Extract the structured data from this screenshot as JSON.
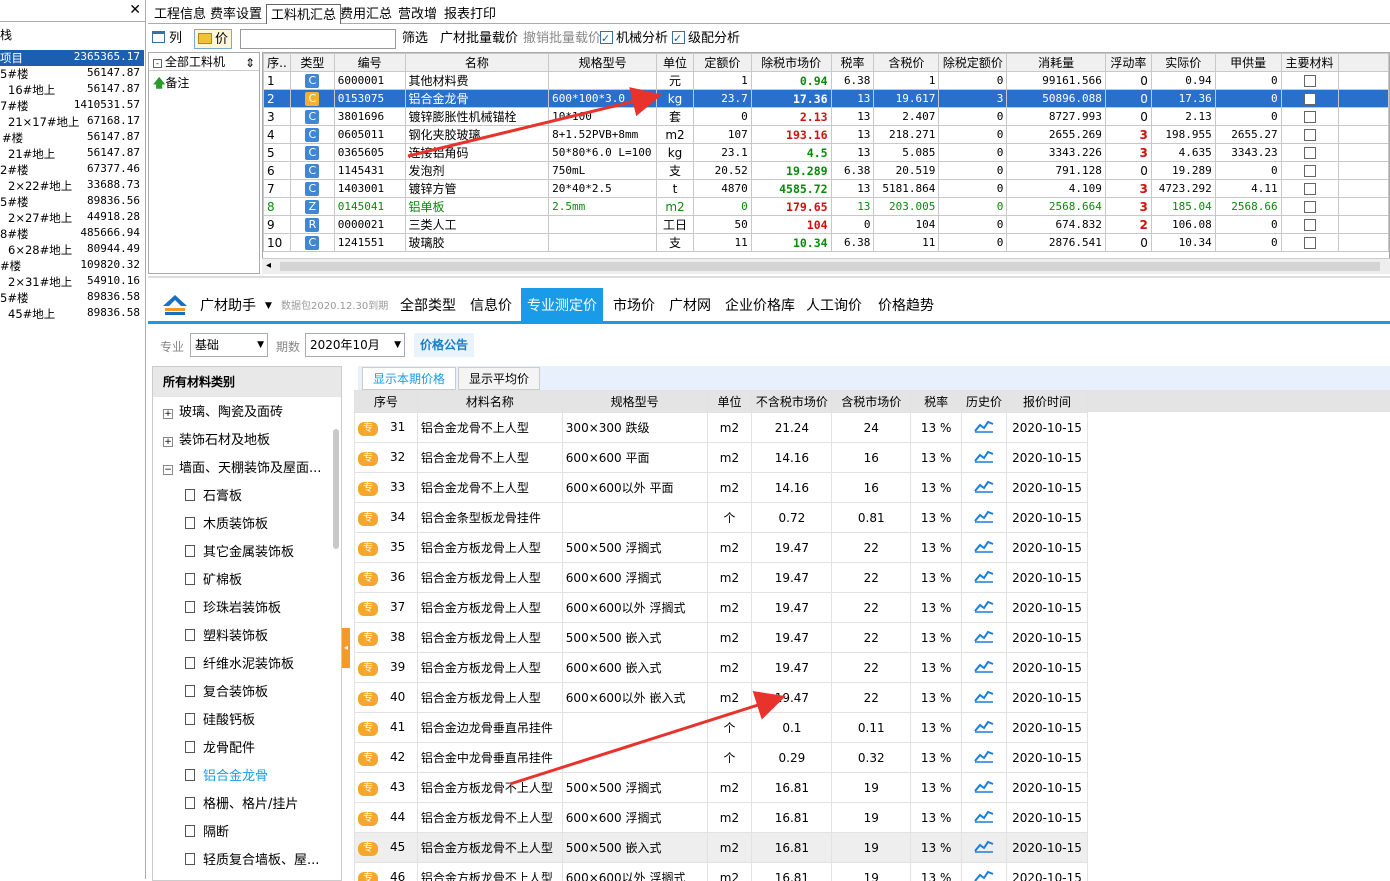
{
  "left_panel": {
    "caption": "栈",
    "rows": [
      {
        "name": "项目",
        "value": "2365365.17",
        "selected": true
      },
      {
        "name": "5#楼",
        "value": "56147.87"
      },
      {
        "name": "16#地上",
        "value": "56147.87"
      },
      {
        "name": "7#楼",
        "value": "1410531.57"
      },
      {
        "name": "21×17#地上",
        "value": "67168.17"
      },
      {
        "name": "#楼",
        "value": "56147.87"
      },
      {
        "name": "21#地上",
        "value": "56147.87"
      },
      {
        "name": "2#楼",
        "value": "67377.46"
      },
      {
        "name": "2×22#地上",
        "value": "33688.73"
      },
      {
        "name": "5#楼",
        "value": "89836.56"
      },
      {
        "name": "2×27#地上",
        "value": "44918.28"
      },
      {
        "name": "8#楼",
        "value": "485666.94"
      },
      {
        "name": "6×28#地上",
        "value": "80944.49"
      },
      {
        "name": "#楼",
        "value": "109820.32"
      },
      {
        "name": "2×31#地上",
        "value": "54910.16"
      },
      {
        "name": "5#楼",
        "value": "89836.58"
      },
      {
        "name": "45#地上",
        "value": "89836.58"
      }
    ]
  },
  "menu": [
    "工程信息",
    "费率设置",
    "工料机汇总",
    "费用汇总",
    "营改增",
    "报表打印"
  ],
  "toolbar": {
    "col_label": "列",
    "price_label": "价",
    "filter_label": "筛选",
    "batch_load": "广材批量载价",
    "undo_batch": "撤销批量载价",
    "machine_analysis": "机械分析",
    "grade_analysis": "级配分析"
  },
  "tree": {
    "header": "全部工料机",
    "note": "备注"
  },
  "grid1": {
    "columns": [
      "序..",
      "类型",
      "编号",
      "名称",
      "规格型号",
      "单位",
      "定额价",
      "除税市场价",
      "税率",
      "含税价",
      "除税定额价",
      "消耗量",
      "浮动率",
      "实际价",
      "甲供量",
      "主要材料"
    ],
    "rows": [
      {
        "no": "1",
        "type": "C",
        "code": "6000001",
        "name": "其他材料费",
        "spec": "",
        "unit": "元",
        "quota": "1",
        "market": "0.94",
        "tax": "6.38",
        "taxp": "1",
        "notax_q": "0",
        "qty": "99161.566",
        "float": "0",
        "actual": "0.94",
        "jia": "0"
      },
      {
        "no": "2",
        "type": "C",
        "code": "0153075",
        "name": "铝合金龙骨",
        "spec": "600*100*3.0",
        "unit": "kg",
        "quota": "23.7",
        "market": "17.36",
        "tax": "13",
        "taxp": "19.617",
        "notax_q": "3",
        "qty": "50896.088",
        "float": "0",
        "actual": "17.36",
        "jia": "0",
        "selected": true
      },
      {
        "no": "3",
        "type": "C",
        "code": "3801696",
        "name": "镀锌膨胀性机械锚栓",
        "spec": "10*100",
        "unit": "套",
        "quota": "0",
        "market": "2.13",
        "tax": "13",
        "taxp": "2.407",
        "notax_q": "0",
        "qty": "8727.993",
        "float": "0",
        "actual": "2.13",
        "jia": "0"
      },
      {
        "no": "4",
        "type": "C",
        "code": "0605011",
        "name": "钢化夹胶玻璃",
        "spec": "8+1.52PVB+8mm",
        "unit": "m2",
        "quota": "107",
        "market": "193.16",
        "tax": "13",
        "taxp": "218.271",
        "notax_q": "0",
        "qty": "2655.269",
        "float": "3",
        "actual": "198.955",
        "jia": "2655.27"
      },
      {
        "no": "5",
        "type": "C",
        "code": "0365605",
        "name": "连接铝角码",
        "spec": "50*80*6.0 L=100",
        "unit": "kg",
        "quota": "23.1",
        "market": "4.5",
        "tax": "13",
        "taxp": "5.085",
        "notax_q": "0",
        "qty": "3343.226",
        "float": "3",
        "actual": "4.635",
        "jia": "3343.23"
      },
      {
        "no": "6",
        "type": "C",
        "code": "1145431",
        "name": "发泡剂",
        "spec": "750mL",
        "unit": "支",
        "quota": "20.52",
        "market": "19.289",
        "tax": "6.38",
        "taxp": "20.519",
        "notax_q": "0",
        "qty": "791.128",
        "float": "0",
        "actual": "19.289",
        "jia": "0"
      },
      {
        "no": "7",
        "type": "C",
        "code": "1403001",
        "name": "镀锌方管",
        "spec": "20*40*2.5",
        "unit": "t",
        "quota": "4870",
        "market": "4585.72",
        "tax": "13",
        "taxp": "5181.864",
        "notax_q": "0",
        "qty": "4.109",
        "float": "3",
        "actual": "4723.292",
        "jia": "4.11"
      },
      {
        "no": "8",
        "type": "Z",
        "code": "0145041",
        "name": "铝单板",
        "spec": "2.5mm",
        "unit": "m2",
        "quota": "0",
        "market": "179.65",
        "tax": "13",
        "taxp": "203.005",
        "notax_q": "0",
        "qty": "2568.664",
        "float": "3",
        "actual": "185.04",
        "jia": "2568.66"
      },
      {
        "no": "9",
        "type": "R",
        "code": "0000021",
        "name": "三类人工",
        "spec": "",
        "unit": "工日",
        "quota": "50",
        "market": "104",
        "tax": "0",
        "taxp": "104",
        "notax_q": "0",
        "qty": "674.832",
        "float": "2",
        "actual": "106.08",
        "jia": "0"
      },
      {
        "no": "10",
        "type": "C",
        "code": "1241551",
        "name": "玻璃胶",
        "spec": "",
        "unit": "支",
        "quota": "11",
        "market": "10.34",
        "tax": "6.38",
        "taxp": "11",
        "notax_q": "0",
        "qty": "2876.541",
        "float": "0",
        "actual": "10.34",
        "jia": "0"
      }
    ]
  },
  "assist": {
    "title": "广材助手",
    "version": "数据包2020.12.30到期",
    "tabs": [
      "全部类型",
      "信息价",
      "专业测定价",
      "市场价",
      "广材网",
      "企业价格库",
      "人工询价",
      "价格趋势"
    ],
    "selected_tab": "专业测定价",
    "filter": {
      "major_label": "专业",
      "major_value": "基础",
      "period_label": "期数",
      "period_value": "2020年10月",
      "announce": "价格公告"
    },
    "categories_title": "所有材料类别",
    "categories": [
      {
        "label": "玻璃、陶瓷及面砖",
        "kind": "plus"
      },
      {
        "label": "装饰石材及地板",
        "kind": "plus"
      },
      {
        "label": "墙面、天棚装饰及屋面...",
        "kind": "minus"
      },
      {
        "label": "石膏板",
        "kind": "leaf"
      },
      {
        "label": "木质装饰板",
        "kind": "leaf"
      },
      {
        "label": "其它金属装饰板",
        "kind": "leaf"
      },
      {
        "label": "矿棉板",
        "kind": "leaf"
      },
      {
        "label": "珍珠岩装饰板",
        "kind": "leaf"
      },
      {
        "label": "塑料装饰板",
        "kind": "leaf"
      },
      {
        "label": "纤维水泥装饰板",
        "kind": "leaf"
      },
      {
        "label": "复合装饰板",
        "kind": "leaf"
      },
      {
        "label": "硅酸钙板",
        "kind": "leaf"
      },
      {
        "label": "龙骨配件",
        "kind": "leaf"
      },
      {
        "label": "铝合金龙骨",
        "kind": "leaf",
        "active": true
      },
      {
        "label": "格栅、格片/挂片",
        "kind": "leaf"
      },
      {
        "label": "隔断",
        "kind": "leaf"
      },
      {
        "label": "轻质复合墙板、屋...",
        "kind": "leaf"
      }
    ],
    "price_tabs": [
      "显示本期价格",
      "显示平均价"
    ],
    "price_columns": [
      "序号",
      "材料名称",
      "规格型号",
      "单位",
      "不含税市场价",
      "含税市场价",
      "税率",
      "历史价",
      "报价时间"
    ],
    "badge": "专",
    "prices": [
      {
        "no": "31",
        "name": "铝合金龙骨不上人型",
        "spec": "300×300 跌级",
        "unit": "m2",
        "p1": "21.24",
        "p2": "24",
        "tax": "13 %",
        "date": "2020-10-15"
      },
      {
        "no": "32",
        "name": "铝合金龙骨不上人型",
        "spec": "600×600 平面",
        "unit": "m2",
        "p1": "14.16",
        "p2": "16",
        "tax": "13 %",
        "date": "2020-10-15"
      },
      {
        "no": "33",
        "name": "铝合金龙骨不上人型",
        "spec": "600×600以外 平面",
        "unit": "m2",
        "p1": "14.16",
        "p2": "16",
        "tax": "13 %",
        "date": "2020-10-15"
      },
      {
        "no": "34",
        "name": "铝合金条型板龙骨挂件",
        "spec": "",
        "unit": "个",
        "p1": "0.72",
        "p2": "0.81",
        "tax": "13 %",
        "date": "2020-10-15"
      },
      {
        "no": "35",
        "name": "铝合金方板龙骨上人型",
        "spec": "500×500 浮搁式",
        "unit": "m2",
        "p1": "19.47",
        "p2": "22",
        "tax": "13 %",
        "date": "2020-10-15"
      },
      {
        "no": "36",
        "name": "铝合金方板龙骨上人型",
        "spec": "600×600 浮搁式",
        "unit": "m2",
        "p1": "19.47",
        "p2": "22",
        "tax": "13 %",
        "date": "2020-10-15"
      },
      {
        "no": "37",
        "name": "铝合金方板龙骨上人型",
        "spec": "600×600以外 浮搁式",
        "unit": "m2",
        "p1": "19.47",
        "p2": "22",
        "tax": "13 %",
        "date": "2020-10-15"
      },
      {
        "no": "38",
        "name": "铝合金方板龙骨上人型",
        "spec": "500×500 嵌入式",
        "unit": "m2",
        "p1": "19.47",
        "p2": "22",
        "tax": "13 %",
        "date": "2020-10-15"
      },
      {
        "no": "39",
        "name": "铝合金方板龙骨上人型",
        "spec": "600×600 嵌入式",
        "unit": "m2",
        "p1": "19.47",
        "p2": "22",
        "tax": "13 %",
        "date": "2020-10-15"
      },
      {
        "no": "40",
        "name": "铝合金方板龙骨上人型",
        "spec": "600×600以外 嵌入式",
        "unit": "m2",
        "p1": "19.47",
        "p2": "22",
        "tax": "13 %",
        "date": "2020-10-15"
      },
      {
        "no": "41",
        "name": "铝合金边龙骨垂直吊挂件",
        "spec": "",
        "unit": "个",
        "p1": "0.1",
        "p2": "0.11",
        "tax": "13 %",
        "date": "2020-10-15"
      },
      {
        "no": "42",
        "name": "铝合金中龙骨垂直吊挂件",
        "spec": "",
        "unit": "个",
        "p1": "0.29",
        "p2": "0.32",
        "tax": "13 %",
        "date": "2020-10-15"
      },
      {
        "no": "43",
        "name": "铝合金方板龙骨不上人型",
        "spec": "500×500 浮搁式",
        "unit": "m2",
        "p1": "16.81",
        "p2": "19",
        "tax": "13 %",
        "date": "2020-10-15"
      },
      {
        "no": "44",
        "name": "铝合金方板龙骨不上人型",
        "spec": "600×600 浮搁式",
        "unit": "m2",
        "p1": "16.81",
        "p2": "19",
        "tax": "13 %",
        "date": "2020-10-15"
      },
      {
        "no": "45",
        "name": "铝合金方板龙骨不上人型",
        "spec": "500×500 嵌入式",
        "unit": "m2",
        "p1": "16.81",
        "p2": "19",
        "tax": "13 %",
        "date": "2020-10-15",
        "hl": true
      },
      {
        "no": "46",
        "name": "铝合金方板龙骨不上人型",
        "spec": "600×600以外 浮搁式",
        "unit": "m2",
        "p1": "16.81",
        "p2": "19",
        "tax": "13 %",
        "date": "2020-10-15"
      }
    ]
  },
  "colors": {
    "accent": "#1a9be8",
    "selected_row": "#2a6fcc",
    "arrow": "#e8322c",
    "badge": "#f4a72a"
  }
}
